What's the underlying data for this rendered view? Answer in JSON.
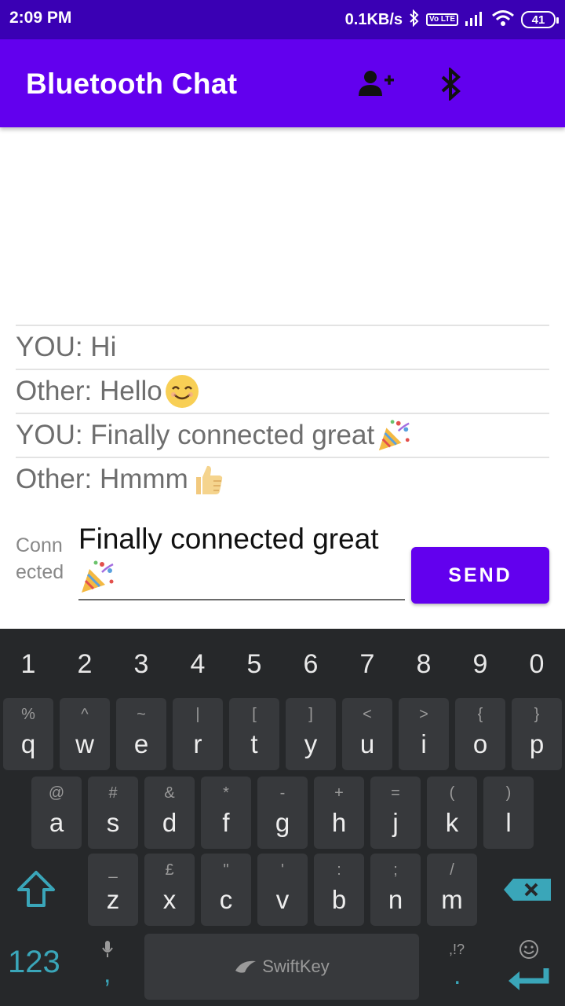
{
  "status_bar": {
    "time": "2:09 PM",
    "net_speed": "0.1KB/s",
    "volte": "Vo LTE",
    "battery": "41"
  },
  "app_bar": {
    "title": "Bluetooth Chat"
  },
  "messages": [
    {
      "text": "YOU:  Hi",
      "emoji": ""
    },
    {
      "text": "Other:  Hello",
      "emoji": "smiling-face"
    },
    {
      "text": "YOU:  Finally connected great",
      "emoji": "party-popper"
    },
    {
      "text": "Other:  Hmmm",
      "emoji": "thumbs-up"
    }
  ],
  "composer": {
    "status_label": "Connected",
    "input_value": "Finally connected great",
    "input_emoji": "party-popper",
    "send_label": "SEND"
  },
  "keyboard": {
    "numbers": [
      "1",
      "2",
      "3",
      "4",
      "5",
      "6",
      "7",
      "8",
      "9",
      "0"
    ],
    "row1": [
      {
        "p": "q",
        "s": "%"
      },
      {
        "p": "w",
        "s": "^"
      },
      {
        "p": "e",
        "s": "~"
      },
      {
        "p": "r",
        "s": "|"
      },
      {
        "p": "t",
        "s": "["
      },
      {
        "p": "y",
        "s": "]"
      },
      {
        "p": "u",
        "s": "<"
      },
      {
        "p": "i",
        "s": ">"
      },
      {
        "p": "o",
        "s": "{"
      },
      {
        "p": "p",
        "s": "}"
      }
    ],
    "row2": [
      {
        "p": "a",
        "s": "@"
      },
      {
        "p": "s",
        "s": "#"
      },
      {
        "p": "d",
        "s": "&"
      },
      {
        "p": "f",
        "s": "*"
      },
      {
        "p": "g",
        "s": "-"
      },
      {
        "p": "h",
        "s": "+"
      },
      {
        "p": "j",
        "s": "="
      },
      {
        "p": "k",
        "s": "("
      },
      {
        "p": "l",
        "s": ")"
      }
    ],
    "row3": [
      {
        "p": "z",
        "s": "_"
      },
      {
        "p": "x",
        "s": "£"
      },
      {
        "p": "c",
        "s": "\""
      },
      {
        "p": "v",
        "s": "'"
      },
      {
        "p": "b",
        "s": ":"
      },
      {
        "p": "n",
        "s": ";"
      },
      {
        "p": "m",
        "s": "/"
      }
    ],
    "num_toggle": "123",
    "comma": ",",
    "space_brand": "SwiftKey",
    "period_secondary": ",!?",
    "period": "."
  },
  "colors": {
    "status_bar": "#3a00b4",
    "primary": "#6200ee",
    "keyboard_bg": "#26282a",
    "key_bg": "#37393c",
    "accent_teal": "#3aa6b9"
  }
}
